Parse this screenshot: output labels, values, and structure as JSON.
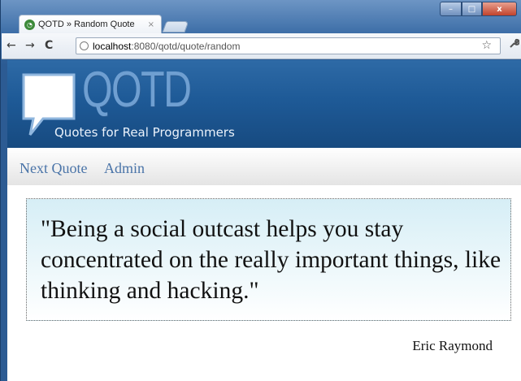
{
  "browser": {
    "tab_title": "QOTD » Random Quote",
    "tab_close": "×",
    "url_host": "localhost",
    "url_rest": ":8080/qotd/quote/random",
    "window_controls": {
      "minimize": "–",
      "maximize": "□",
      "close": "x"
    },
    "nav": {
      "back": "←",
      "forward": "→",
      "reload": "C"
    },
    "star": "☆",
    "wrench": "🔧"
  },
  "site": {
    "logo_text": "QOTD",
    "tagline": "Quotes for Real Programmers"
  },
  "nav": {
    "items": [
      {
        "label": "Next Quote"
      },
      {
        "label": "Admin"
      }
    ]
  },
  "quote": {
    "text": "\"Being a social outcast helps you stay concentrated on the really important things, like thinking and hacking.\"",
    "author": "Eric Raymond"
  },
  "colors": {
    "header": "#1e5a97",
    "link": "#4a74a8",
    "quote_bg": "#d6eef6"
  }
}
